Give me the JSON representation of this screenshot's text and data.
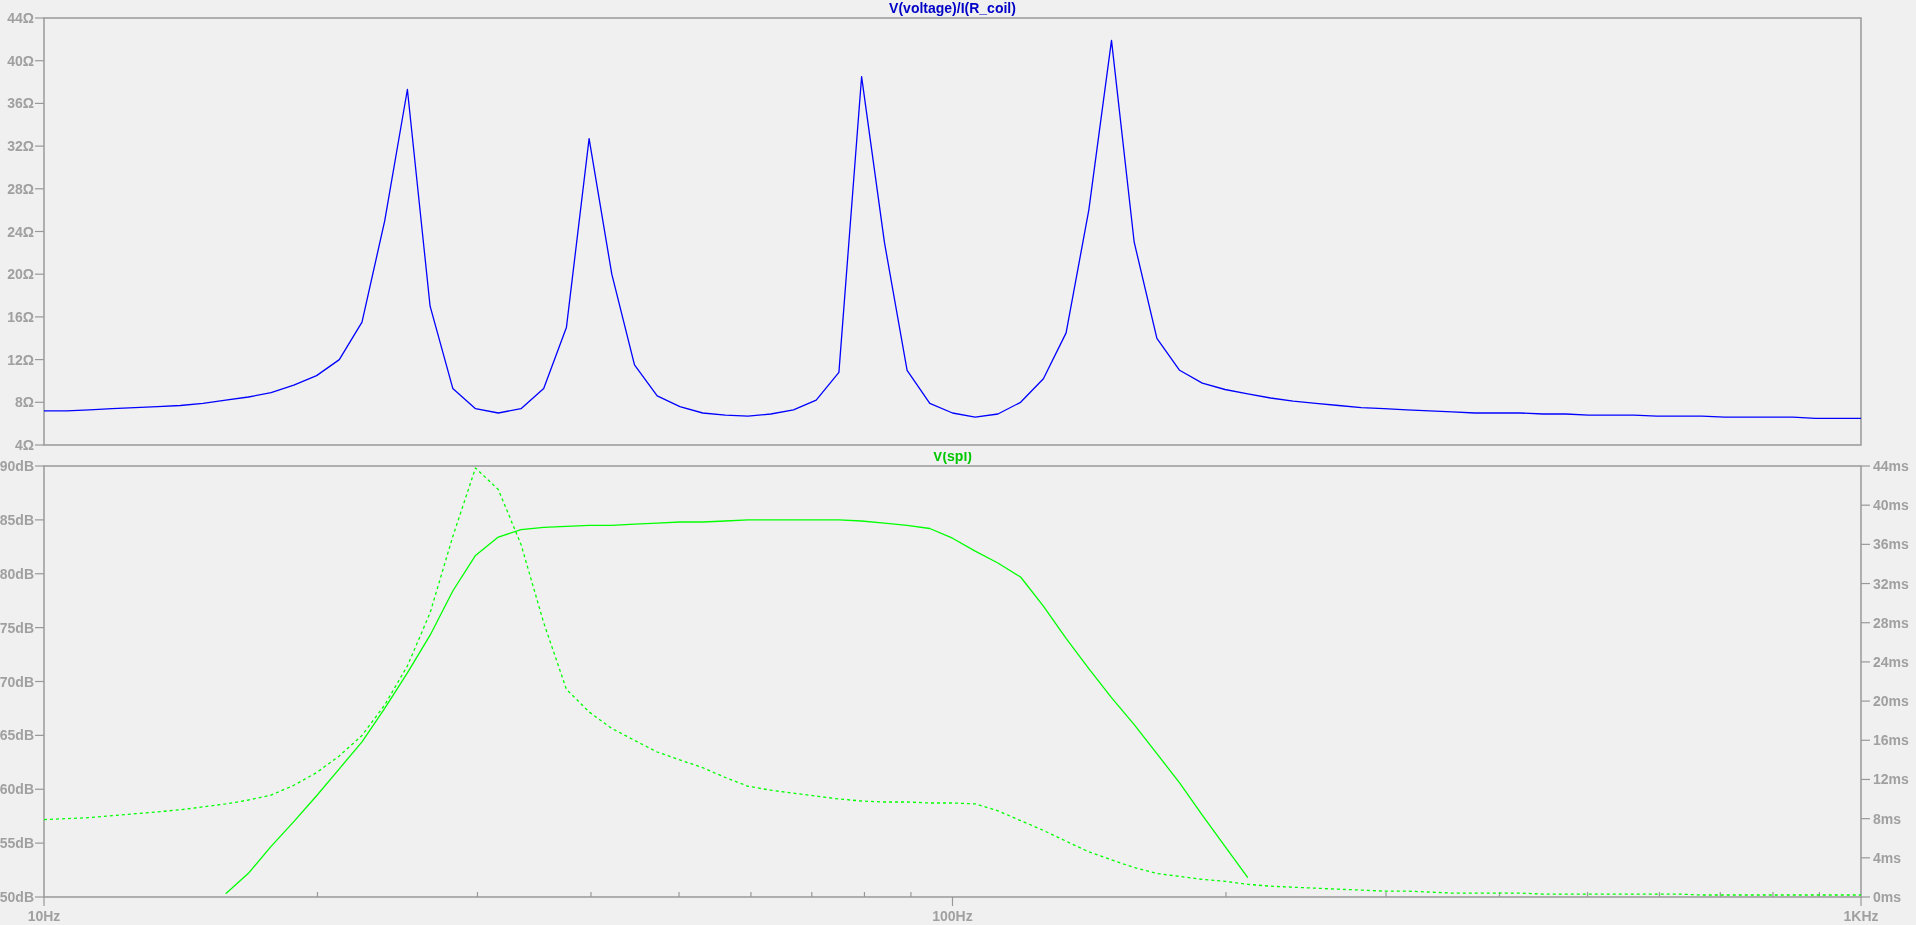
{
  "plots": [
    {
      "chart_data": {
        "type": "line",
        "title": "V(voltage)/I(R_coil)",
        "ylim": [
          4,
          44
        ],
        "yticks": [
          {
            "value": 4,
            "label": "4Ω"
          },
          {
            "value": 8,
            "label": "8Ω"
          },
          {
            "value": 12,
            "label": "12Ω"
          },
          {
            "value": 16,
            "label": "16Ω"
          },
          {
            "value": 20,
            "label": "20Ω"
          },
          {
            "value": 24,
            "label": "24Ω"
          },
          {
            "value": 28,
            "label": "28Ω"
          },
          {
            "value": 32,
            "label": "32Ω"
          },
          {
            "value": 36,
            "label": "36Ω"
          },
          {
            "value": 40,
            "label": "40Ω"
          },
          {
            "value": 44,
            "label": "44Ω"
          }
        ],
        "categories": [
          null,
          null,
          null,
          null,
          null,
          null,
          null,
          null,
          null,
          null,
          null,
          null,
          null,
          null,
          null,
          null,
          null,
          null,
          null,
          null,
          null,
          null,
          null,
          null,
          null,
          null,
          null,
          null,
          null,
          null,
          null,
          null,
          null,
          null,
          null,
          null,
          null,
          null,
          null,
          null,
          null,
          null,
          null,
          null,
          null,
          null,
          null,
          null,
          null,
          null,
          null,
          null,
          null,
          null,
          null,
          null,
          null,
          null,
          null,
          null,
          null,
          null,
          null,
          null,
          null,
          null,
          null,
          null,
          null,
          null,
          null,
          null,
          null,
          null,
          null,
          null,
          null,
          null,
          null,
          null,
          null
        ],
        "series": [
          {
            "color": "#0000ff",
            "values": [
              7.2,
              7.2,
              7.3,
              7.4,
              7.5,
              7.6,
              7.7,
              7.9,
              8.2,
              8.5,
              8.9,
              9.6,
              10.5,
              12,
              15.5,
              25,
              37.3,
              17,
              9.3,
              7.4,
              7,
              7.4,
              9.3,
              15,
              32.7,
              20,
              11.5,
              8.6,
              7.6,
              7,
              6.8,
              6.7,
              6.9,
              7.3,
              8.2,
              10.8,
              38.5,
              23,
              11,
              7.9,
              7,
              6.6,
              6.9,
              8,
              10.2,
              14.5,
              26,
              41.9,
              23,
              14,
              11,
              9.8,
              9.2,
              8.8,
              8.4,
              8.1,
              7.9,
              7.7,
              7.5,
              7.4,
              7.3,
              7.2,
              7.1,
              7,
              7,
              7,
              6.9,
              6.9,
              6.8,
              6.8,
              6.8,
              6.7,
              6.7,
              6.7,
              6.6,
              6.6,
              6.6,
              6.6,
              6.5,
              6.5,
              6.5
            ]
          }
        ]
      }
    },
    {
      "chart_data": {
        "type": "line",
        "title": "V(spl)",
        "ylim": [
          50,
          90
        ],
        "y2lim": [
          0,
          44
        ],
        "categories": [
          "10Hz",
          null,
          null,
          null,
          null,
          null,
          null,
          null,
          null,
          null,
          null,
          null,
          null,
          null,
          null,
          null,
          null,
          null,
          null,
          null,
          null,
          null,
          null,
          null,
          null,
          null,
          null,
          null,
          null,
          null,
          null,
          null,
          null,
          null,
          null,
          null,
          null,
          null,
          null,
          null,
          "100Hz",
          null,
          null,
          null,
          null,
          null,
          null,
          null,
          null,
          null,
          null,
          null,
          null,
          null,
          null,
          null,
          null,
          null,
          null,
          null,
          null,
          null,
          null,
          null,
          null,
          null,
          null,
          null,
          null,
          null,
          null,
          null,
          null,
          null,
          null,
          null,
          null,
          null,
          null,
          null,
          "1KHz"
        ],
        "yticks": [
          {
            "value": 50,
            "label": "50dB"
          },
          {
            "value": 55,
            "label": "55dB"
          },
          {
            "value": 60,
            "label": "60dB"
          },
          {
            "value": 65,
            "label": "65dB"
          },
          {
            "value": 70,
            "label": "70dB"
          },
          {
            "value": 75,
            "label": "75dB"
          },
          {
            "value": 80,
            "label": "80dB"
          },
          {
            "value": 85,
            "label": "85dB"
          },
          {
            "value": 90,
            "label": "90dB"
          }
        ],
        "y2ticks": [
          {
            "value": 0,
            "label": "0ms"
          },
          {
            "value": 4,
            "label": "4ms"
          },
          {
            "value": 8,
            "label": "8ms"
          },
          {
            "value": 12,
            "label": "12ms"
          },
          {
            "value": 16,
            "label": "16ms"
          },
          {
            "value": 20,
            "label": "20ms"
          },
          {
            "value": 24,
            "label": "24ms"
          },
          {
            "value": 28,
            "label": "28ms"
          },
          {
            "value": 32,
            "label": "32ms"
          },
          {
            "value": 36,
            "label": "36ms"
          },
          {
            "value": 40,
            "label": "40ms"
          },
          {
            "value": 44,
            "label": "44ms"
          }
        ],
        "series": [
          {
            "color": "#00ff00",
            "values": [
              null,
              null,
              null,
              null,
              null,
              null,
              null,
              null,
              50.3,
              52.2,
              54.7,
              57,
              59.4,
              61.9,
              64.4,
              67.5,
              70.8,
              74.3,
              78.4,
              81.7,
              83.4,
              84.1,
              84.3,
              84.4,
              84.5,
              84.5,
              84.6,
              84.7,
              84.8,
              84.8,
              84.9,
              85,
              85,
              85,
              85,
              85,
              84.9,
              84.7,
              84.5,
              84.2,
              83.3,
              82.1,
              81,
              79.7,
              77,
              74,
              71.2,
              68.5,
              66,
              63.3,
              60.6,
              57.6,
              54.7,
              51.8,
              null,
              null,
              null,
              null,
              null,
              null,
              null,
              null,
              null,
              null,
              null,
              null,
              null,
              null,
              null,
              null,
              null,
              null,
              null,
              null,
              null,
              null,
              null,
              null,
              null,
              null,
              null
            ]
          },
          {
            "color": "#00ff00",
            "axis": "y2",
            "line_style": "dashed",
            "values": [
              7.9,
              8,
              8.1,
              8.3,
              8.5,
              8.7,
              8.9,
              9.2,
              9.5,
              9.9,
              10.4,
              11.4,
              12.7,
              14.4,
              16.5,
              19.6,
              23.6,
              29,
              36.8,
              43.8,
              41.6,
              36,
              28,
              21.2,
              18.9,
              17.2,
              16,
              14.8,
              14,
              13.2,
              12.2,
              11.3,
              10.9,
              10.6,
              10.3,
              10,
              9.8,
              9.7,
              9.7,
              9.6,
              9.6,
              9.5,
              8.8,
              7.8,
              6.8,
              5.7,
              4.6,
              3.8,
              3,
              2.4,
              2.1,
              1.8,
              1.6,
              1.3,
              1.1,
              1,
              0.9,
              0.8,
              0.7,
              0.6,
              0.6,
              0.5,
              0.4,
              0.4,
              0.4,
              0.4,
              0.3,
              0.3,
              0.3,
              0.3,
              0.3,
              0.3,
              0.3,
              0.2,
              0.2,
              0.2,
              0.2,
              0.2,
              0.2,
              0.2,
              0.2
            ]
          }
        ]
      }
    }
  ]
}
